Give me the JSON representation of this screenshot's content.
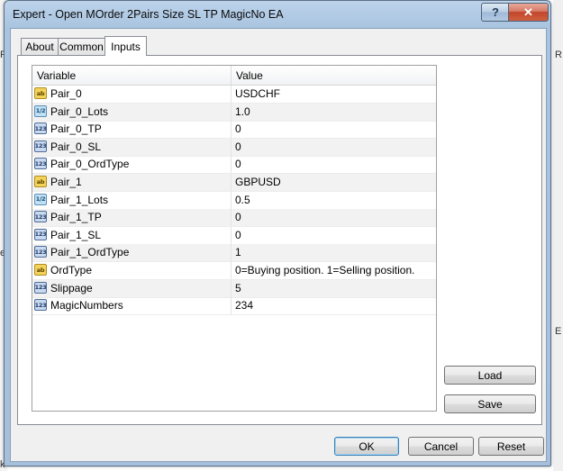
{
  "window": {
    "title": "Expert - Open MOrder 2Pairs Size SL TP MagicNo EA",
    "help_label": "?",
    "close_label": "✕"
  },
  "tabs": [
    {
      "label": "About",
      "active": false
    },
    {
      "label": "Common",
      "active": false
    },
    {
      "label": "Inputs",
      "active": true
    }
  ],
  "grid": {
    "columns": [
      "Variable",
      "Value"
    ],
    "rows": [
      {
        "icon": "ab",
        "name": "Pair_0",
        "value": "USDCHF"
      },
      {
        "icon": "1/2",
        "name": "Pair_0_Lots",
        "value": "1.0"
      },
      {
        "icon": "123",
        "name": "Pair_0_TP",
        "value": "0"
      },
      {
        "icon": "123",
        "name": "Pair_0_SL",
        "value": "0"
      },
      {
        "icon": "123",
        "name": "Pair_0_OrdType",
        "value": "0"
      },
      {
        "icon": "ab",
        "name": "Pair_1",
        "value": "GBPUSD"
      },
      {
        "icon": "1/2",
        "name": "Pair_1_Lots",
        "value": "0.5"
      },
      {
        "icon": "123",
        "name": "Pair_1_TP",
        "value": "0"
      },
      {
        "icon": "123",
        "name": "Pair_1_SL",
        "value": "0"
      },
      {
        "icon": "123",
        "name": "Pair_1_OrdType",
        "value": "1"
      },
      {
        "icon": "ab",
        "name": "OrdType",
        "value": "0=Buying position. 1=Selling position."
      },
      {
        "icon": "123",
        "name": "Slippage",
        "value": "5"
      },
      {
        "icon": "123",
        "name": "MagicNumbers",
        "value": "234"
      }
    ]
  },
  "side_buttons": {
    "load": "Load",
    "save": "Save"
  },
  "footer_buttons": {
    "ok": "OK",
    "cancel": "Cancel",
    "reset": "Reset"
  },
  "background": {
    "left_fragments": [
      "R",
      "es",
      "k"
    ],
    "right_fragments": [
      "R",
      "E"
    ]
  }
}
